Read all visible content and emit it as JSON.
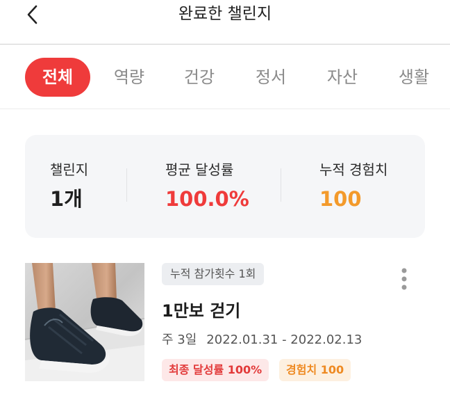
{
  "header": {
    "title": "완료한 챌린지"
  },
  "tabs": [
    {
      "label": "전체",
      "active": true
    },
    {
      "label": "역량",
      "active": false
    },
    {
      "label": "건강",
      "active": false
    },
    {
      "label": "정서",
      "active": false
    },
    {
      "label": "자산",
      "active": false
    },
    {
      "label": "생활",
      "active": false
    }
  ],
  "summary": {
    "challenges": {
      "label": "챌린지",
      "value": "1개"
    },
    "avg_rate": {
      "label": "평균 달성률",
      "value": "100.0%"
    },
    "total_exp": {
      "label": "누적 경험치",
      "value": "100"
    }
  },
  "colors": {
    "accent_red": "#ef3b3b",
    "accent_orange": "#f39a2b",
    "summary_bg": "#f5f6f8"
  },
  "challenge_list": [
    {
      "participation_badge": "누적 참가횟수 1회",
      "title": "1만보 걷기",
      "duration": "주 3일",
      "period": "2022.01.31 - 2022.02.13",
      "final_rate": "최종 달성률 100%",
      "experience": "경험치 100",
      "icons": {
        "more": "more-vertical-icon",
        "image": "sneaker-photo"
      }
    }
  ],
  "icons": {
    "back": "chevron-left-icon"
  }
}
